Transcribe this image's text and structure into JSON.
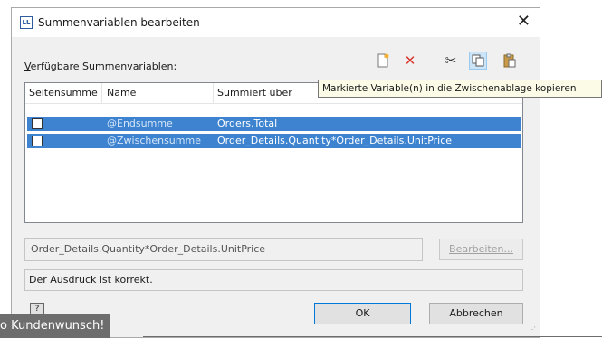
{
  "dialog": {
    "title": "Summenvariablen bearbeiten",
    "app_icon_text": "LL",
    "close_glyph": "✕"
  },
  "section": {
    "label_prefix": "V",
    "label_rest": "erfügbare Summenvariablen:"
  },
  "toolbar": {
    "buttons": [
      {
        "icon": "new-variable-icon",
        "glyph": "🗎"
      },
      {
        "icon": "delete-icon",
        "glyph": "✕"
      },
      {
        "icon": "cut-icon",
        "glyph": "✂"
      },
      {
        "icon": "copy-icon",
        "glyph": "⧉"
      },
      {
        "icon": "paste-icon",
        "glyph": "📋"
      }
    ]
  },
  "tooltip": "Markierte Variable(n) in die Zwischenablage kopieren",
  "table": {
    "columns": [
      "Seitensumme",
      "Name",
      "Summiert über"
    ],
    "rows": [
      {
        "checked": false,
        "name": "@Endsumme",
        "expr": "Orders.Total"
      },
      {
        "checked": false,
        "name": "@Zwischensumme",
        "expr": "Order_Details.Quantity*Order_Details.UnitPrice"
      }
    ]
  },
  "expression_field": "Order_Details.Quantity*Order_Details.UnitPrice",
  "edit_button": "Bearbeiten...",
  "status_text": "Der Ausdruck ist korrekt.",
  "ok_button": "OK",
  "cancel_button": "Abbrechen",
  "caption": "o Kundenwunsch!",
  "colors": {
    "selection": "#3d83cf",
    "delete_red": "#d9342b",
    "caption_bg": "#6d6d6d"
  }
}
